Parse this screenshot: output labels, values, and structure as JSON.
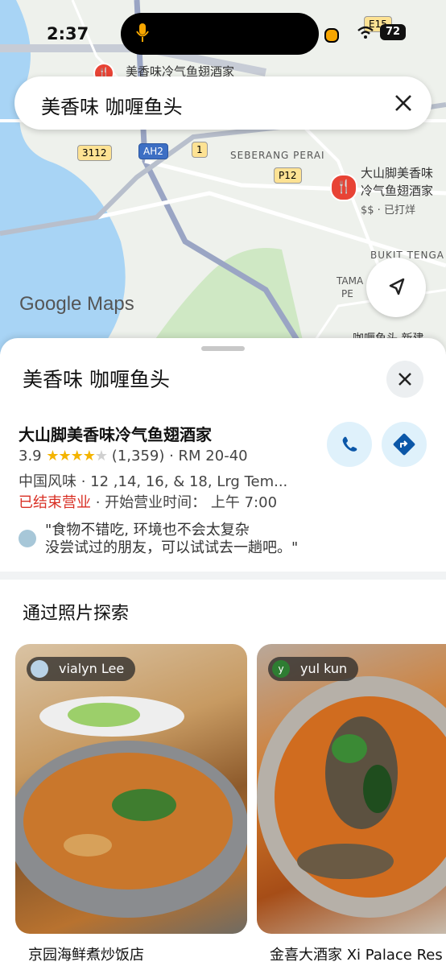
{
  "status_bar": {
    "time": "2:37",
    "battery": "72"
  },
  "search": {
    "query": "美香味 咖喱鱼头"
  },
  "map": {
    "labels": {
      "top_restaurant": "美香味冷气鱼翅酒家",
      "seberang_perai": "SEBERANG PERAI",
      "right_restaurant_line1": "大山脚美香味",
      "right_restaurant_line2": "冷气鱼翅酒家",
      "right_restaurant_info": "$$ · 已打烊",
      "bukit_tengah": "BUKIT TENGA",
      "taman": "TAMA",
      "pe": "PE",
      "bottom_label": "咖喱鱼头 新建"
    },
    "road_badges": {
      "e15": "E15",
      "r3112": "3112",
      "ah2": "AH2",
      "r1": "1",
      "p12": "P12"
    },
    "logo": "Google Maps"
  },
  "sheet": {
    "title": "美香味 咖喱鱼头",
    "place": {
      "name": "大山脚美香味冷气鱼翅酒家",
      "rating": "3.9",
      "stars_filled": "★★★★",
      "stars_empty": "★",
      "review_count": "(1,359)",
      "price": "· RM 20-40",
      "category": "中国风味 · 12 ,14, 16, & 18, Lrg Tem...",
      "status_closed": "已结束营业",
      "status_open_time": " · 开始营业时间： 上午 7:00",
      "review": "\"食物不错吃, 环境也不会太复杂\n没尝试过的朋友，可以试试去一趟吧。\""
    },
    "explore_title": "通过照片探索",
    "photos": [
      {
        "author": "vialyn Lee",
        "caption": "京园海鲜煮炒饭店"
      },
      {
        "author": "yul kun",
        "author_initial": "y",
        "caption": "金喜大酒家 Xi Palace Res"
      }
    ]
  },
  "colors": {
    "accent_blue": "#1a73e8",
    "closed_red": "#d93025",
    "star": "#f4b400"
  }
}
